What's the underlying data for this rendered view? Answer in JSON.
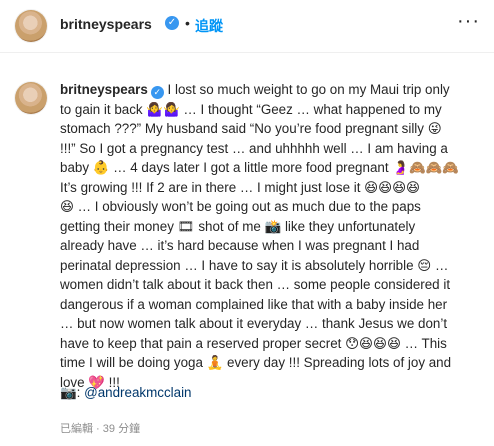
{
  "header": {
    "username": "britneyspears",
    "verified_glyph": "✓",
    "separator": "•",
    "follow_label": "追蹤",
    "more_glyph": "···",
    "avatar_icon": "profile-photo"
  },
  "post": {
    "username": "britneyspears",
    "verified_glyph": "✓",
    "lines": [
      " I lost so much weight to go on my Maui trip only",
      "to gain it back 🤷‍♀️🤷‍♀️ … I thought “Geez … what happened to my",
      "stomach ???” My husband said “No you’re food pregnant silly 😜",
      "!!!” So I got a pregnancy test … and uhhhhh well … I am having a",
      "baby 👶 … 4 days later I got a little more food pregnant 🤰🙈🙈🙈",
      "It’s growing !!! If 2 are in there … I might just lose it 😆😆😆😆",
      "😆 … I obviously won’t be going out as much due to the paps",
      "getting their money 🎞 shot of me 📸 like they unfortunately",
      "already have … it’s hard because when I was pregnant I had",
      "perinatal depression … I have to say it is absolutely horrible 😔 …",
      "women didn’t talk about it back then … some people considered it",
      "dangerous if a woman complained like that with a baby inside her",
      "… but now women talk about it everyday … thank Jesus we don’t",
      "have to keep that pain a reserved proper secret 😯😆😆😆 … This",
      "time I will be doing yoga 🧘 every day !!! Spreading lots of joy and",
      "love 💖 !!!"
    ],
    "mention_prefix": "📷: ",
    "mention": "@andreakmcclain",
    "meta": "已編輯 · 39 分鐘"
  }
}
